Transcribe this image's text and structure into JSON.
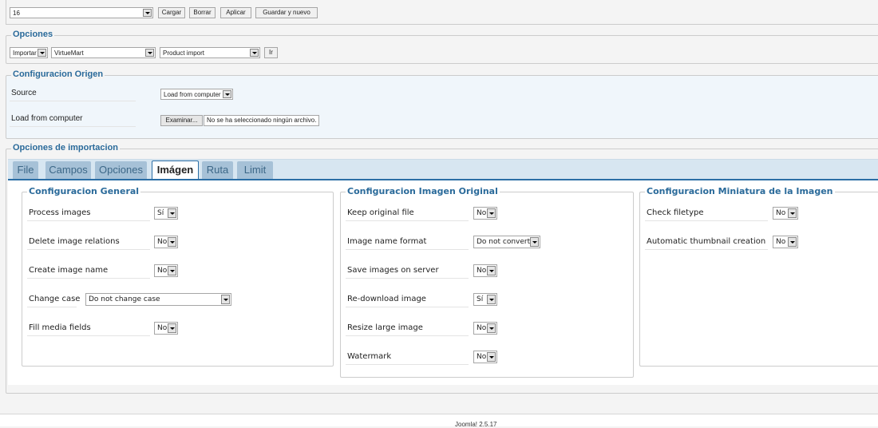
{
  "template_bar": {
    "selected": "16",
    "buttons": [
      "Cargar",
      "Borrar",
      "Aplicar",
      "Guardar y nuevo"
    ]
  },
  "opciones": {
    "title": "Opciones",
    "action": "Importar",
    "component": "VirtueMart",
    "operation": "Product import",
    "go_label": "Ir"
  },
  "origen": {
    "title": "Configuracion Origen",
    "source_label": "Source",
    "source_value": "Load from computer",
    "load_label": "Load from computer",
    "browse_label": "Examinar...",
    "no_file": "No se ha seleccionado ningún archivo."
  },
  "import_options": {
    "title": "Opciones de importacion",
    "tabs": [
      "File",
      "Campos",
      "Opciones",
      "Imágen",
      "Ruta",
      "Limit"
    ],
    "active_tab": "Imágen"
  },
  "general": {
    "title": "Configuracion General",
    "fields": [
      {
        "label": "Process images",
        "value": "Sí"
      },
      {
        "label": "Delete image relations",
        "value": "No"
      },
      {
        "label": "Create image name",
        "value": "No"
      },
      {
        "label": "Change case",
        "value": "Do not change case"
      },
      {
        "label": "Fill media fields",
        "value": "No"
      }
    ]
  },
  "original": {
    "title": "Configuracion Imagen Original",
    "fields": [
      {
        "label": "Keep original file",
        "value": "No"
      },
      {
        "label": "Image name format",
        "value": "Do not convert"
      },
      {
        "label": "Save images on server",
        "value": "No"
      },
      {
        "label": "Re-download image",
        "value": "Sí"
      },
      {
        "label": "Resize large image",
        "value": "No"
      },
      {
        "label": "Watermark",
        "value": "No"
      }
    ]
  },
  "thumb": {
    "title": "Configuracion Miniatura de la Imagen",
    "fields": [
      {
        "label": "Check filetype",
        "value": "No"
      },
      {
        "label": "Automatic thumbnail creation",
        "value": "No"
      }
    ]
  },
  "footer": {
    "version": "Joomla! 2.5.17"
  },
  "colors": {
    "legend": "#2a6a9a",
    "tab_active_border": "#2b6ea5",
    "tab_bg": "#a6c1d7"
  }
}
